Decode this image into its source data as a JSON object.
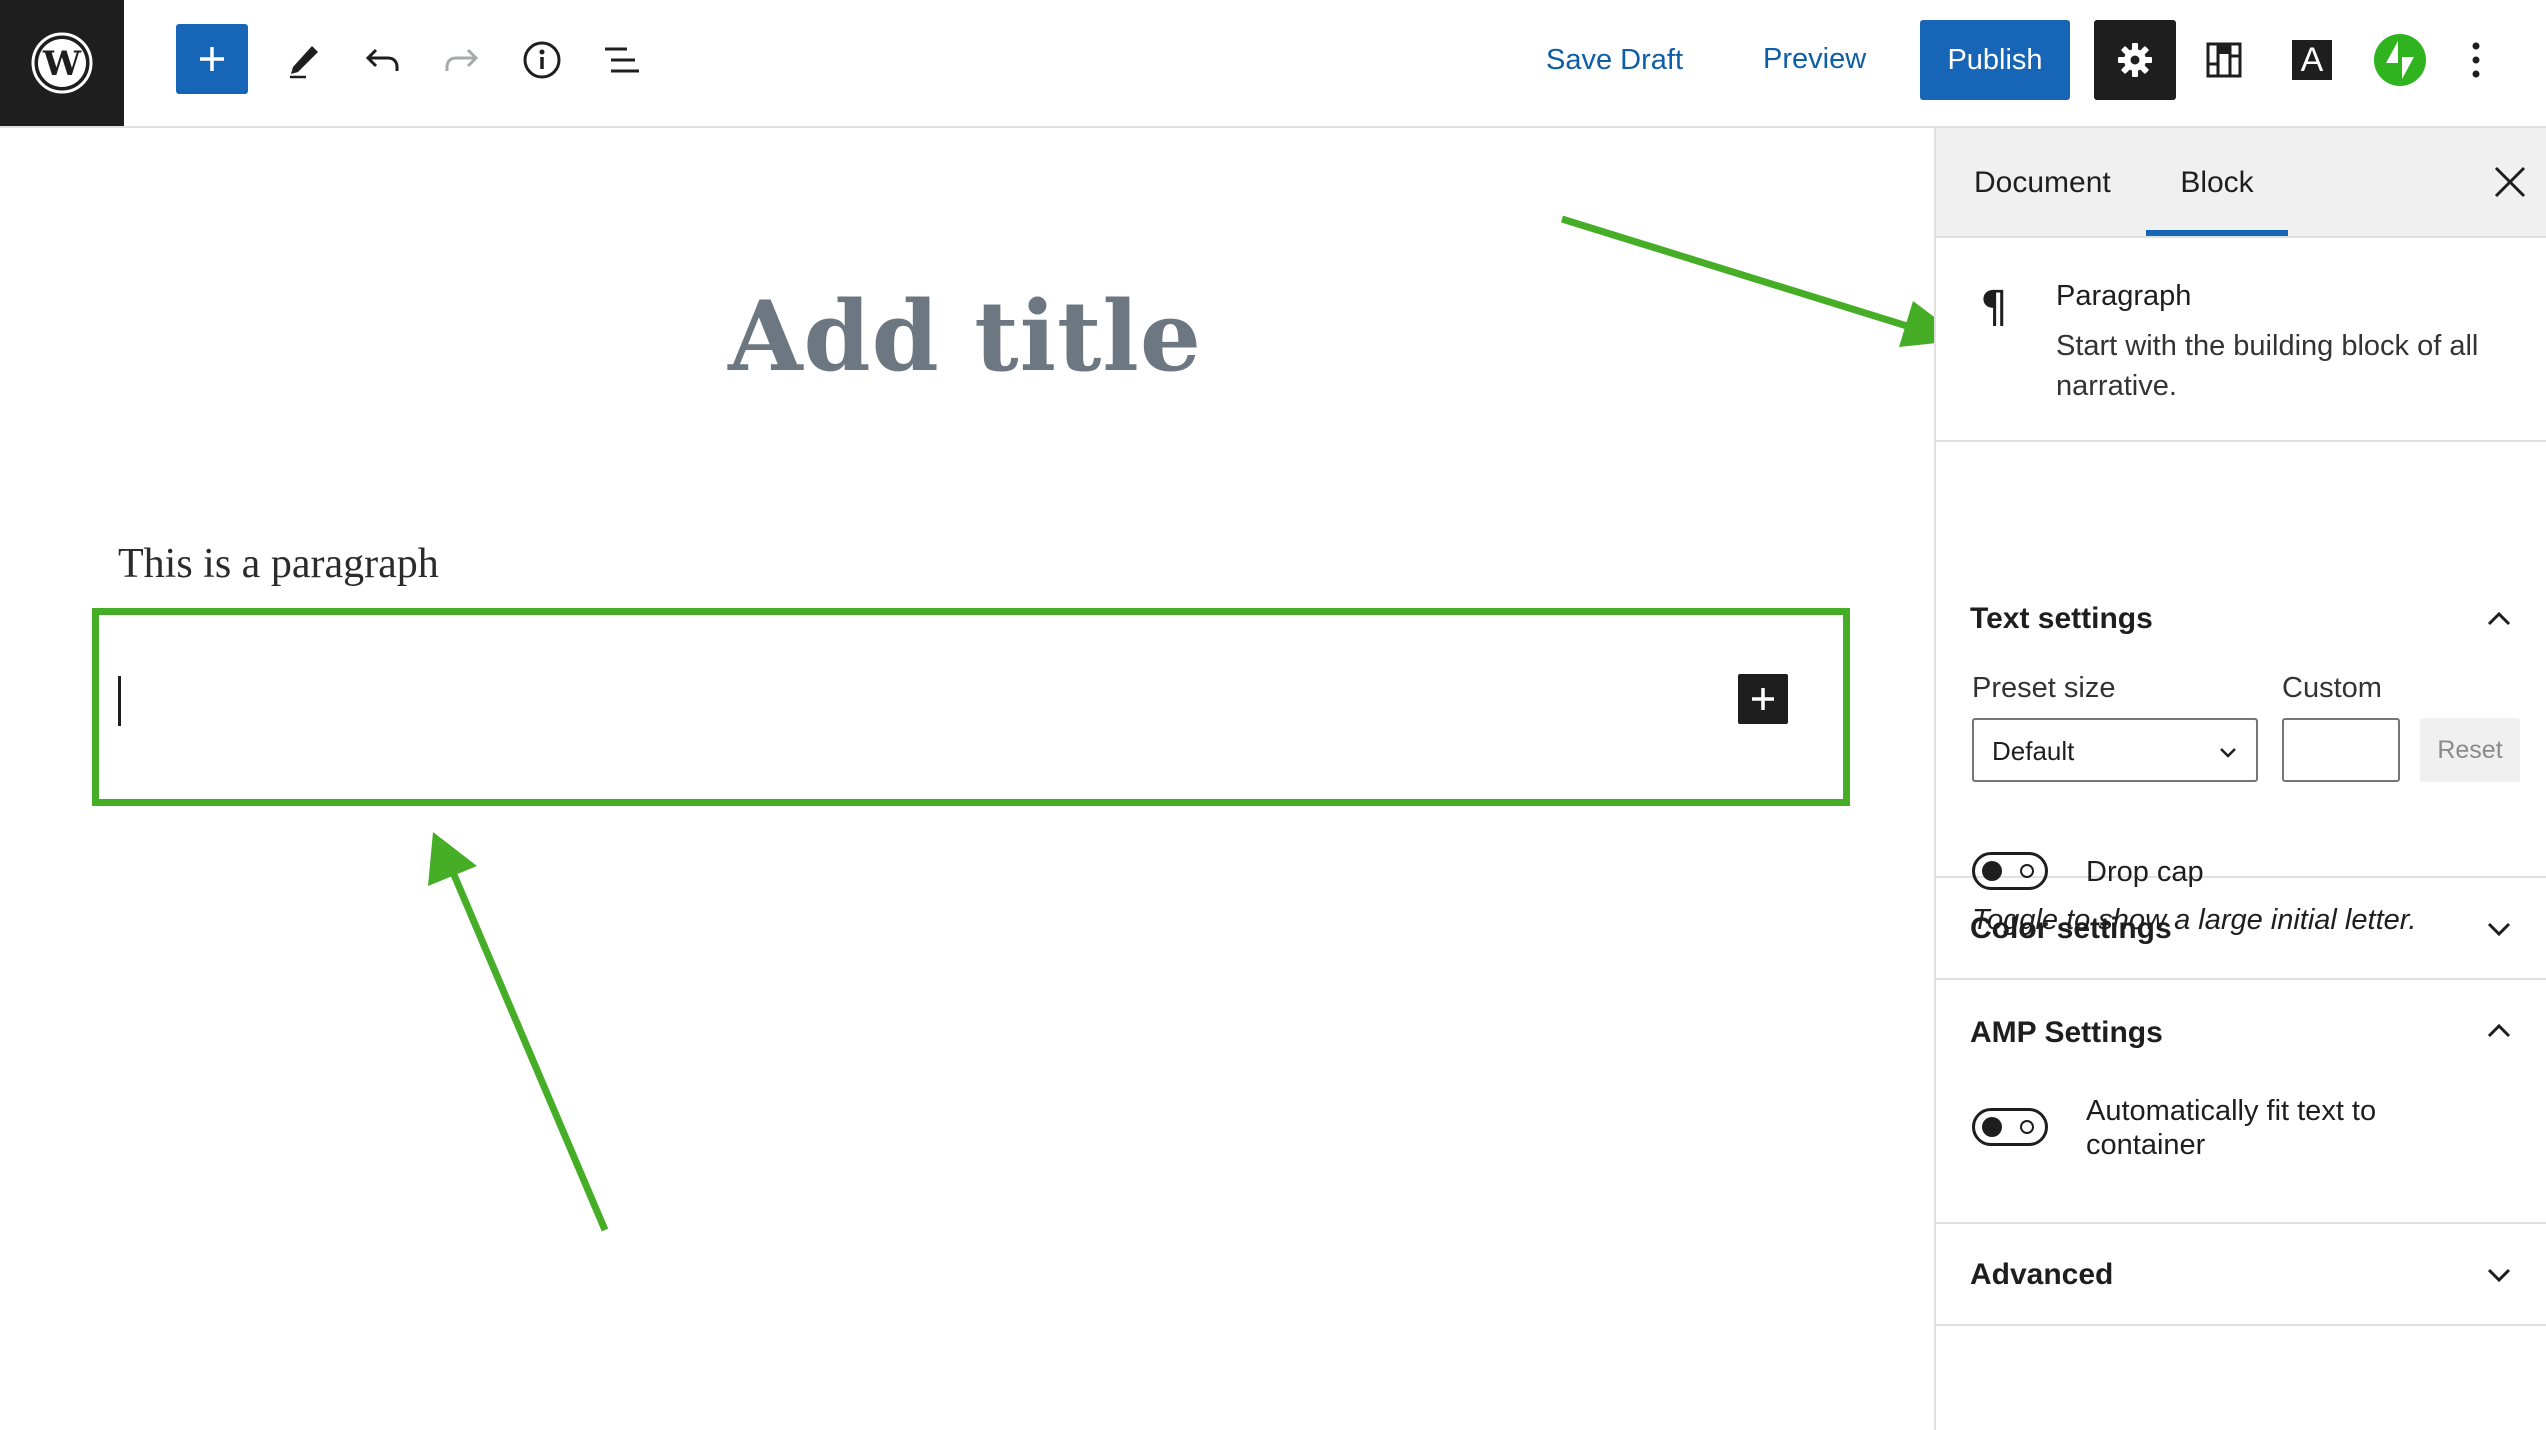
{
  "toolbar": {
    "logo": "wordpress-icon",
    "save_draft": "Save Draft",
    "preview": "Preview",
    "publish": "Publish",
    "plugin_a_letter": "A"
  },
  "editor": {
    "title_placeholder": "Add title",
    "paragraph_1": "This is a paragraph"
  },
  "sidebar": {
    "tabs": [
      "Document",
      "Block"
    ],
    "active_tab": "Block",
    "block_card": {
      "icon": "pilcrow-icon",
      "name": "Paragraph",
      "description": "Start with the building block of all narrative."
    },
    "text_settings": {
      "title": "Text settings",
      "preset_size_label": "Preset size",
      "preset_size_value": "Default",
      "custom_label": "Custom",
      "custom_value": "",
      "reset": "Reset",
      "drop_cap_label": "Drop cap",
      "drop_cap_help": "Toggle to show a large initial letter."
    },
    "color_settings": {
      "title": "Color settings"
    },
    "amp_settings": {
      "title": "AMP Settings",
      "auto_fit_label": "Automatically fit text to container"
    },
    "advanced": {
      "title": "Advanced"
    }
  },
  "colors": {
    "accent": "#1665b6",
    "annotation": "#46ad26",
    "dark": "#1e1e1e",
    "jetpack": "#2fb41f"
  }
}
